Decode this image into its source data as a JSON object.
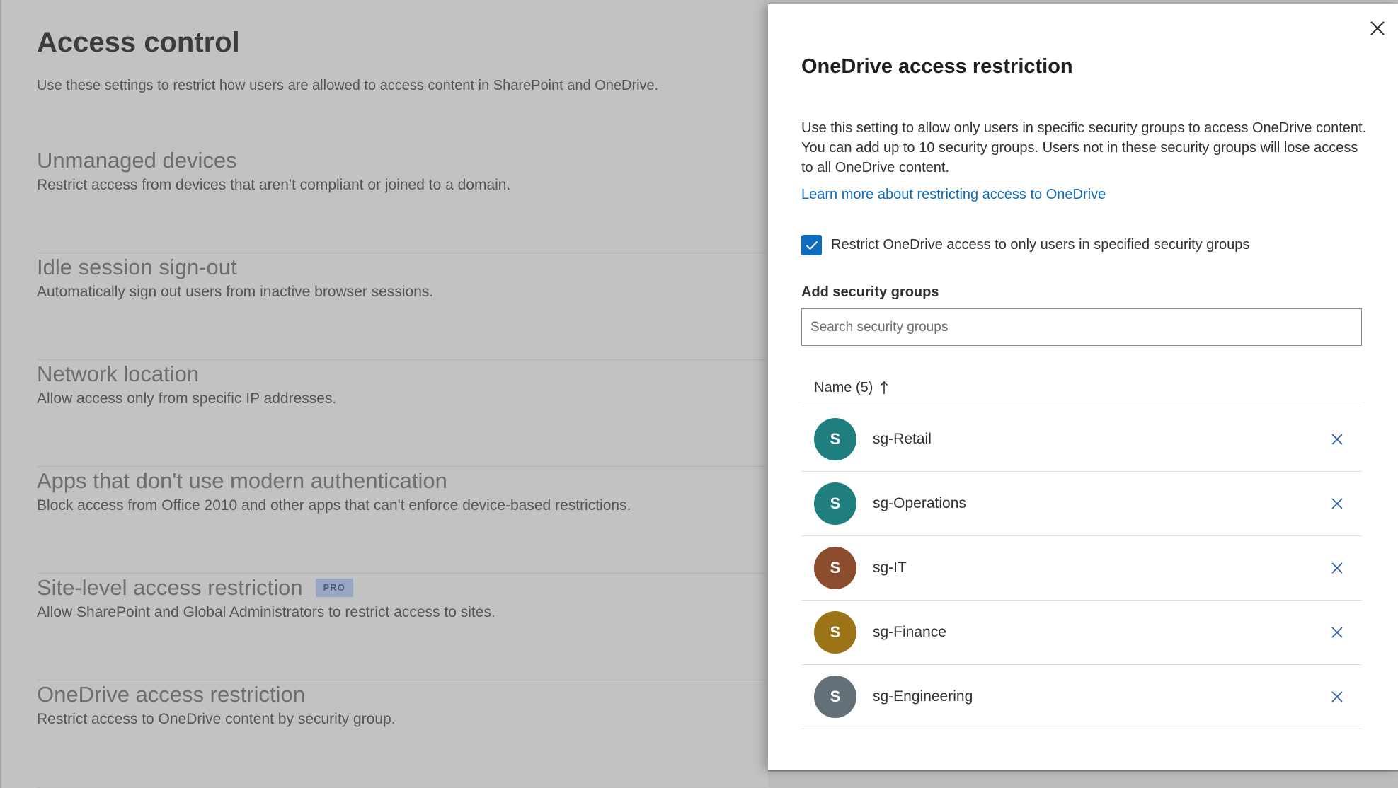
{
  "background": {
    "title": "Access control",
    "subtitle": "Use these settings to restrict how users are allowed to access content in SharePoint and OneDrive.",
    "sections": [
      {
        "title": "Unmanaged devices",
        "description": "Restrict access from devices that aren't compliant or joined to a domain."
      },
      {
        "title": "Idle session sign-out",
        "description": "Automatically sign out users from inactive browser sessions."
      },
      {
        "title": "Network location",
        "description": "Allow access only from specific IP addresses."
      },
      {
        "title": "Apps that don't use modern authentication",
        "description": "Block access from Office 2010 and other apps that can't enforce device-based restrictions."
      },
      {
        "title": "Site-level access restriction",
        "badge": "PRO",
        "description": "Allow SharePoint and Global Administrators to restrict access to sites."
      },
      {
        "title": "OneDrive access restriction",
        "description": "Restrict access to OneDrive content by security group."
      }
    ]
  },
  "panel": {
    "title": "OneDrive access restriction",
    "description": "Use this setting to allow only users in specific security groups to access OneDrive content. You can add up to 10 security groups. Users not in these security groups will lose access to all OneDrive content.",
    "learn_more": "Learn more about restricting access to OneDrive",
    "checkbox_label": "Restrict OneDrive access to only users in specified security groups",
    "checkbox_checked": true,
    "add_groups_label": "Add security groups",
    "search_placeholder": "Search security groups",
    "search_value": "",
    "list_header": "Name (5)",
    "groups": [
      {
        "initial": "S",
        "name": "sg-Retail",
        "color": "#1f7f7f"
      },
      {
        "initial": "S",
        "name": "sg-Operations",
        "color": "#1f7f7f"
      },
      {
        "initial": "S",
        "name": "sg-IT",
        "color": "#8c4c2e"
      },
      {
        "initial": "S",
        "name": "sg-Finance",
        "color": "#9a7416"
      },
      {
        "initial": "S",
        "name": "sg-Engineering",
        "color": "#637078"
      }
    ]
  },
  "colors": {
    "accent": "#0f6cbd",
    "overlay": "#c2c2c2"
  },
  "icons": {
    "close": "close-icon",
    "checkmark": "checkmark-icon",
    "sort": "arrow-up-icon",
    "remove": "remove-icon"
  }
}
